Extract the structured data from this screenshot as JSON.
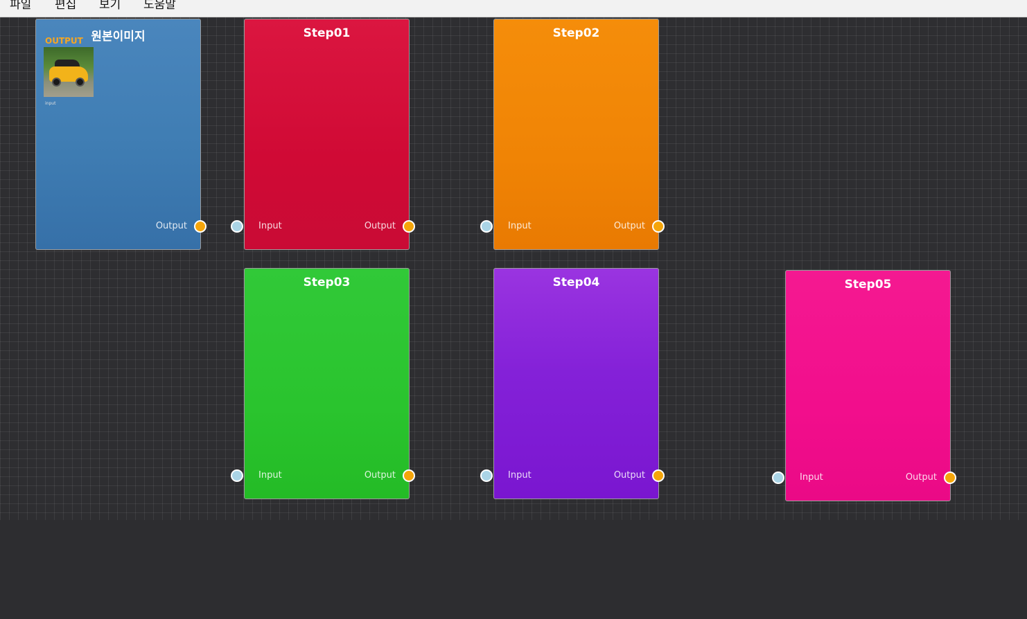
{
  "menu": {
    "items": [
      "파일",
      "편집",
      "보기",
      "도움말"
    ]
  },
  "nodes": {
    "source": {
      "title": "원본이미지",
      "thumb_label": "OUTPUT",
      "thumb_caption": "input",
      "output_label": "Output",
      "color": "#3a78b0"
    },
    "step01": {
      "title": "Step01",
      "input_label": "Input",
      "output_label": "Output",
      "color": "#d41038"
    },
    "step02": {
      "title": "Step02",
      "input_label": "Input",
      "output_label": "Output",
      "color": "#f08305"
    },
    "step03": {
      "title": "Step03",
      "input_label": "Input",
      "output_label": "Output",
      "color": "#2ac42e"
    },
    "step04": {
      "title": "Step04",
      "input_label": "Input",
      "output_label": "Output",
      "color": "#8421d8"
    },
    "step05": {
      "title": "Step05",
      "input_label": "Input",
      "output_label": "Output",
      "color": "#f20e8c"
    }
  },
  "colors": {
    "input_port": "#aad4e6",
    "output_port": "#f5a50a",
    "canvas_bg": "#2e2e31"
  },
  "icons": {
    "input_port": "circle-port-icon",
    "output_port": "circle-port-icon"
  }
}
